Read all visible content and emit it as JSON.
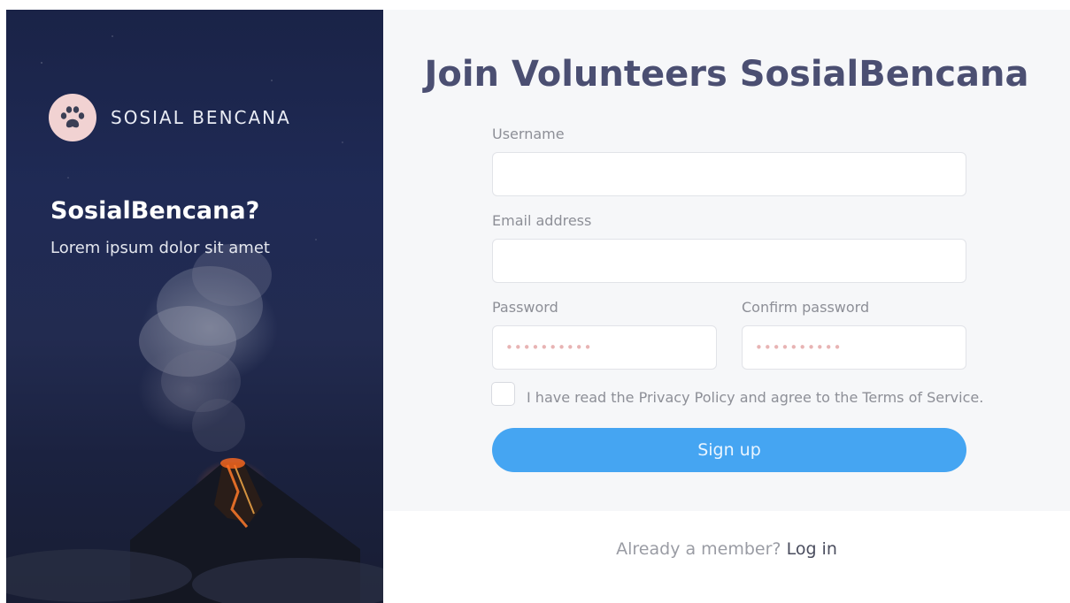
{
  "hero": {
    "brand": "SOSIAL BENCANA",
    "title": "SosialBencana?",
    "subtitle": "Lorem ipsum dolor sit amet",
    "logo_icon": "paw-icon"
  },
  "form": {
    "title": "Join Volunteers SosialBencana",
    "username_label": "Username",
    "username_value": "",
    "email_label": "Email address",
    "email_value": "",
    "password_label": "Password",
    "password_placeholder": "••••••••••",
    "confirm_label": "Confirm password",
    "confirm_placeholder": "••••••••••",
    "agree_text": "I have read the Privacy Policy and agree to the Terms of Service.",
    "agree_checked": false,
    "submit_label": "Sign up"
  },
  "footer": {
    "prompt": "Already a member?",
    "login_label": "Log in"
  },
  "colors": {
    "title": "#4b4f72",
    "button": "#45a5f2",
    "logo_badge": "#f1d2d2",
    "panel_bg": "#f6f7f9"
  }
}
